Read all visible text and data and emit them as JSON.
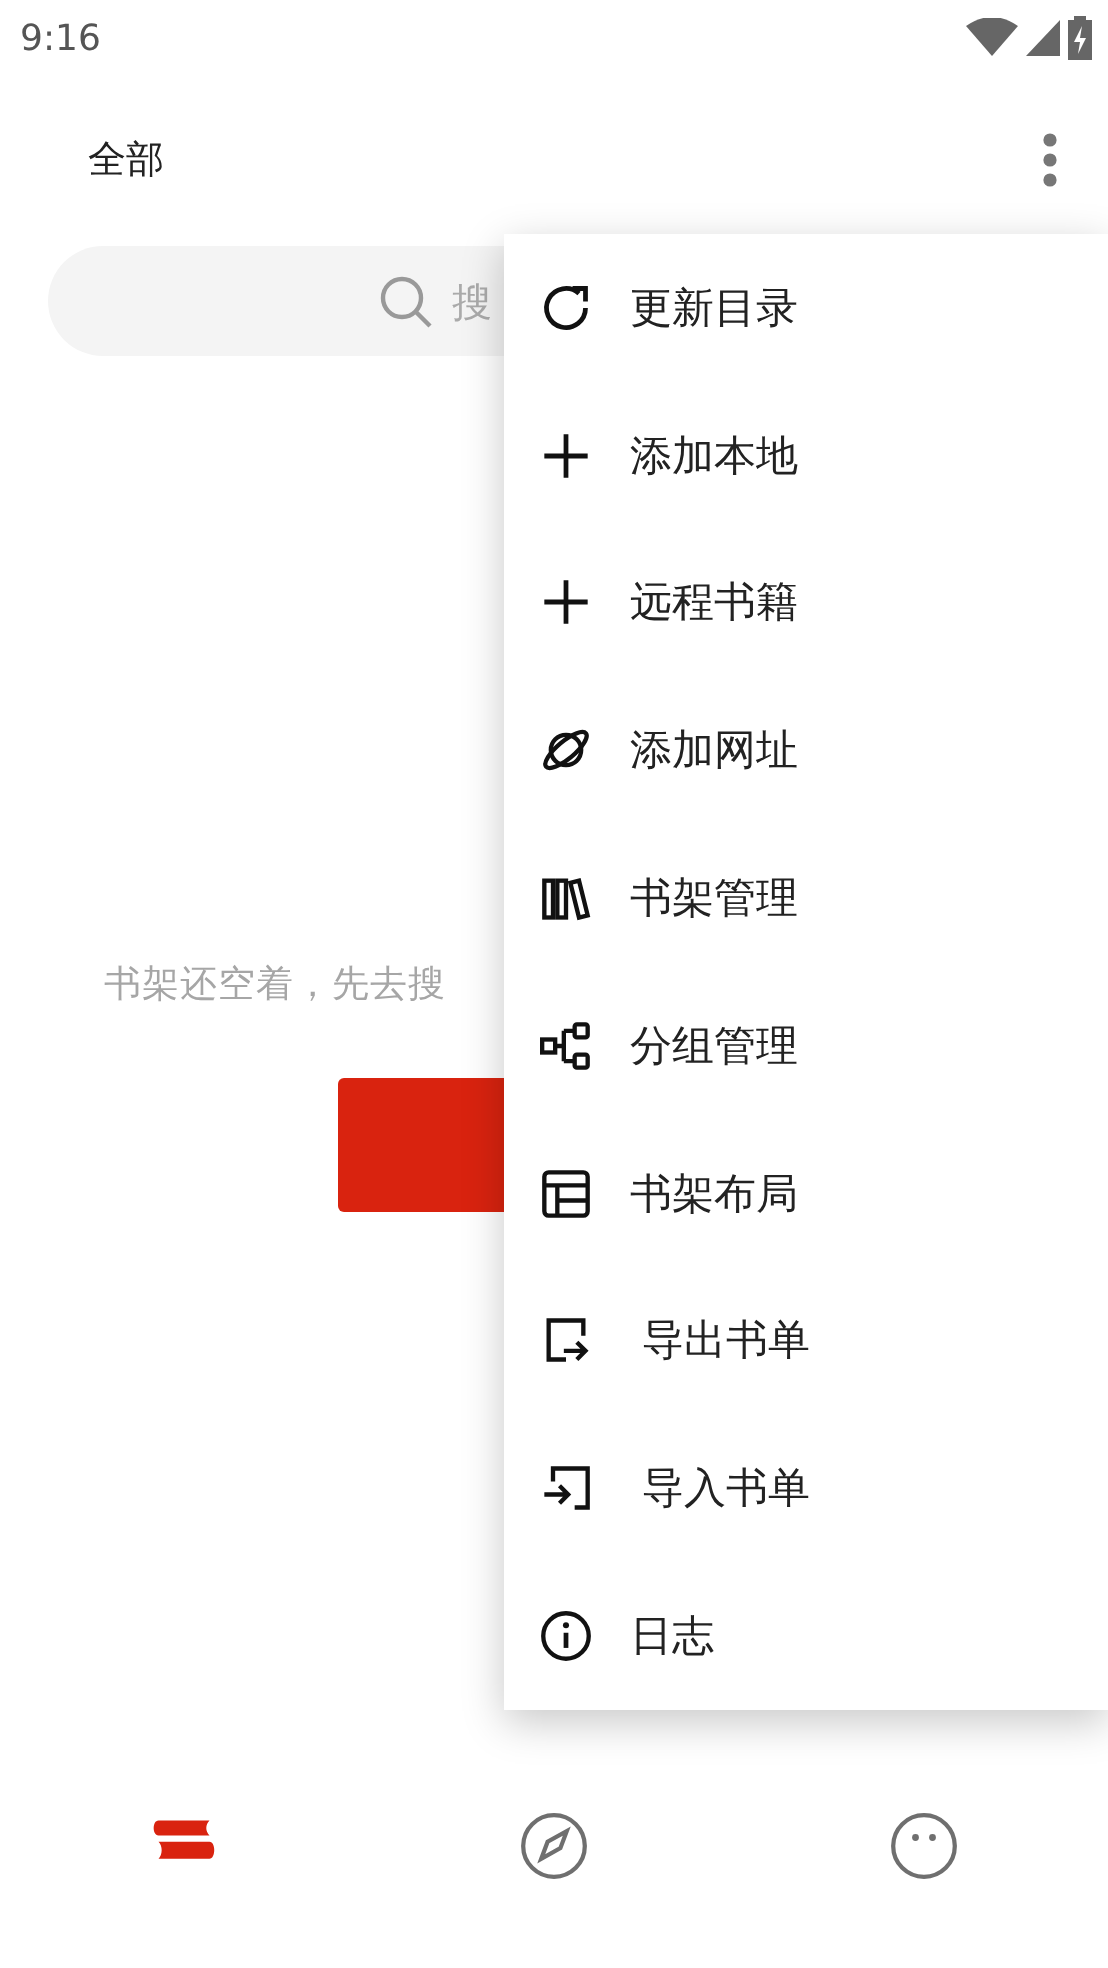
{
  "status_bar": {
    "time": "9:16"
  },
  "top_bar": {
    "title": "全部"
  },
  "search": {
    "placeholder": "搜"
  },
  "empty_state": {
    "message": "书架还空着，先去搜"
  },
  "menu": {
    "items": [
      {
        "label": "更新目录"
      },
      {
        "label": "添加本地"
      },
      {
        "label": "远程书籍"
      },
      {
        "label": "添加网址"
      },
      {
        "label": "书架管理"
      },
      {
        "label": "分组管理"
      },
      {
        "label": "书架布局"
      },
      {
        "label": "导出书单"
      },
      {
        "label": "导入书单"
      },
      {
        "label": "日志"
      }
    ]
  },
  "bottom_nav": {
    "items": [
      {
        "selected": true
      },
      {
        "selected": false
      },
      {
        "selected": false
      }
    ]
  }
}
